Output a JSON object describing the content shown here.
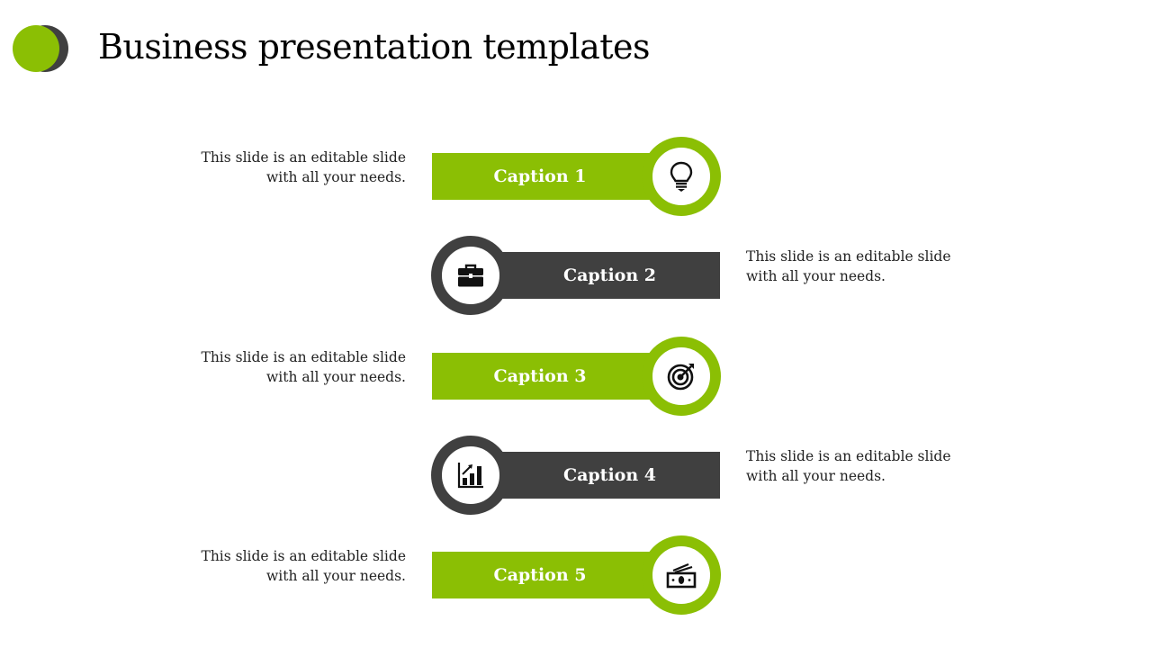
{
  "header": {
    "title": "Business presentation templates"
  },
  "colors": {
    "accent_green": "#8bbf04",
    "accent_dark": "#404040"
  },
  "items": [
    {
      "caption": "Caption 1",
      "icon": "lightbulb-icon",
      "style": "green",
      "desc_side": "left",
      "desc_line1": "This slide is an editable slide",
      "desc_line2": "with all your needs."
    },
    {
      "caption": "Caption 2",
      "icon": "briefcase-icon",
      "style": "dark",
      "desc_side": "right",
      "desc_line1": "This slide is an editable slide",
      "desc_line2": "with all your needs."
    },
    {
      "caption": "Caption 3",
      "icon": "target-icon",
      "style": "green",
      "desc_side": "left",
      "desc_line1": "This slide is an editable slide",
      "desc_line2": "with all your needs."
    },
    {
      "caption": "Caption 4",
      "icon": "bar-chart-icon",
      "style": "dark",
      "desc_side": "right",
      "desc_line1": "This slide is an editable slide",
      "desc_line2": "with all your needs."
    },
    {
      "caption": "Caption 5",
      "icon": "money-icon",
      "style": "green",
      "desc_side": "left",
      "desc_line1": "This slide is an editable slide",
      "desc_line2": "with all your needs."
    }
  ]
}
